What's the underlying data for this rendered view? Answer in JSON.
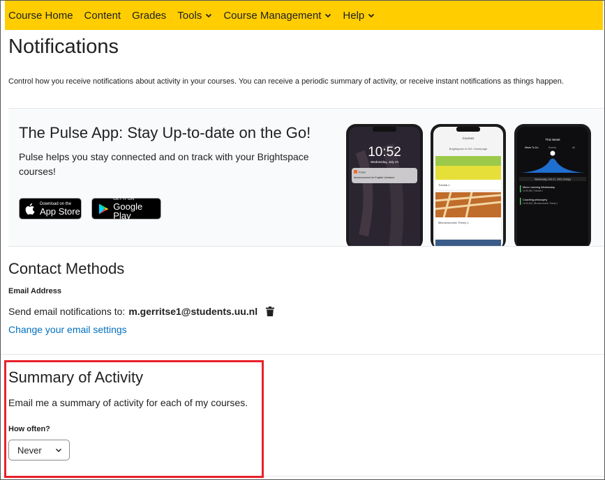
{
  "nav": {
    "items": [
      {
        "label": "Course Home",
        "has_menu": false
      },
      {
        "label": "Content",
        "has_menu": false
      },
      {
        "label": "Grades",
        "has_menu": false
      },
      {
        "label": "Tools",
        "has_menu": true
      },
      {
        "label": "Course Management",
        "has_menu": true
      },
      {
        "label": "Help",
        "has_menu": true
      }
    ],
    "bg_color": "#ffcd00"
  },
  "page": {
    "title": "Notifications",
    "intro": "Control how you receive notifications about activity in your courses. You can receive a periodic summary of activity, or receive instant notifications as things happen."
  },
  "pulse": {
    "title": "The Pulse App: Stay Up-to-date on the Go!",
    "text": "Pulse helps you stay connected and on track with your Brightspace courses!",
    "app_store": {
      "small": "Download on the",
      "big": "App Store"
    },
    "google_play": {
      "small": "GET IT ON",
      "big": "Google Play"
    },
    "phone1": {
      "time": "10:52",
      "date": "Wednesday, July 24",
      "notif_app": "Pulse",
      "notif_text": "Announcement for English Literature"
    },
    "phone2": {
      "header": "Courses",
      "sub": "Brightspace to D2L Homepage",
      "card1": "Tutorial 1",
      "card2": "Microeconomic Theory 1"
    },
    "phone3": {
      "header": "This Week",
      "tabs": [
        "Week To Do",
        "Events",
        "All"
      ],
      "date": "Wednesday, Feb 17, 2021 (Today)",
      "item1": "Micro Learning Wednesday",
      "item1_sub": "11:59 AM | Tutorial 1",
      "item2": "Coaching philosophy",
      "item2_sub": "11:59 AM | Microeconomic Theory 1"
    }
  },
  "contact": {
    "title": "Contact Methods",
    "email_label": "Email Address",
    "send_prefix": "Send email notifications to:",
    "email": "m.gerritse1@students.uu.nl",
    "change_link": "Change your email settings"
  },
  "summary": {
    "title": "Summary of Activity",
    "text": "Email me a summary of activity for each of my courses.",
    "how_often_label": "How often?",
    "selected": "Never",
    "highlight_color": "#e8202a"
  },
  "link_color": "#006fbf"
}
